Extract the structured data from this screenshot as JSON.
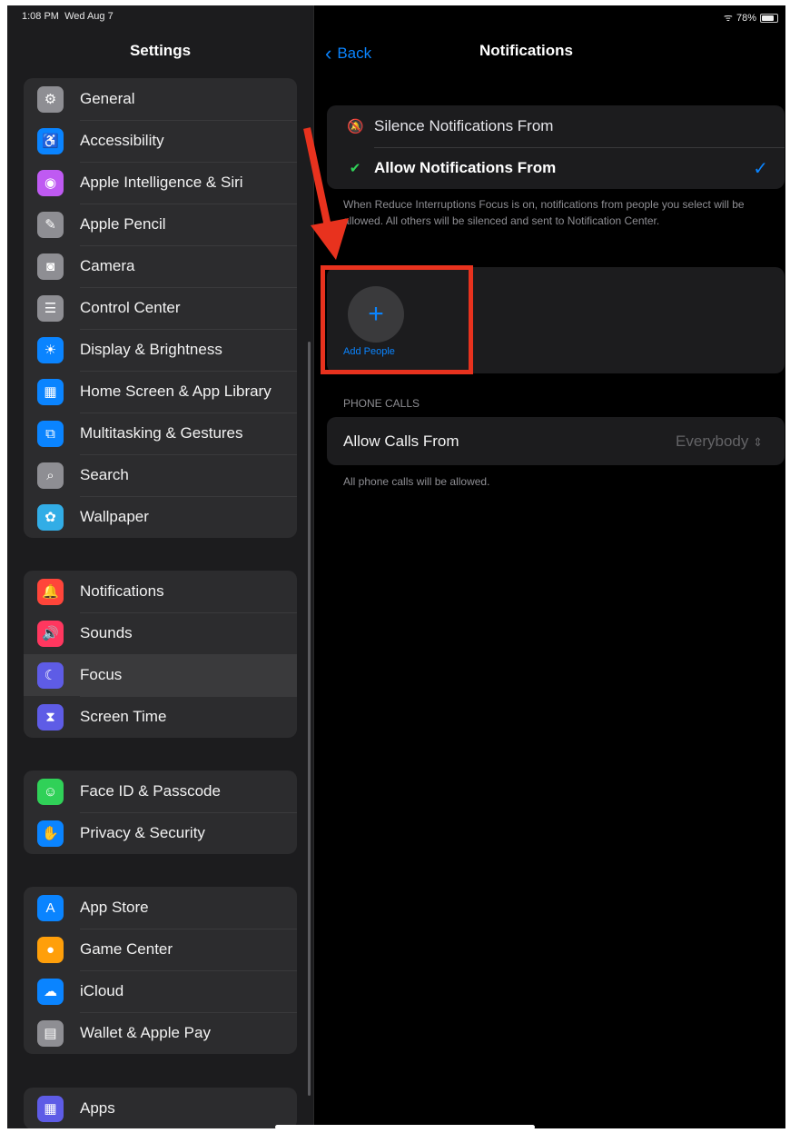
{
  "status": {
    "time": "1:08 PM",
    "date": "Wed Aug 7",
    "battery": "78%"
  },
  "sidebar": {
    "title": "Settings",
    "groups": [
      [
        {
          "label": "General",
          "icon": "gear-icon",
          "color": "#8e8e93"
        },
        {
          "label": "Accessibility",
          "icon": "accessibility-icon",
          "color": "#0a84ff"
        },
        {
          "label": "Apple Intelligence & Siri",
          "icon": "siri-icon",
          "color": "#bf5af2"
        },
        {
          "label": "Apple Pencil",
          "icon": "pencil-icon",
          "color": "#8e8e93"
        },
        {
          "label": "Camera",
          "icon": "camera-icon",
          "color": "#8e8e93"
        },
        {
          "label": "Control Center",
          "icon": "control-center-icon",
          "color": "#8e8e93"
        },
        {
          "label": "Display & Brightness",
          "icon": "sun-icon",
          "color": "#0a84ff"
        },
        {
          "label": "Home Screen & App Library",
          "icon": "home-screen-icon",
          "color": "#0a84ff"
        },
        {
          "label": "Multitasking & Gestures",
          "icon": "multitasking-icon",
          "color": "#0a84ff"
        },
        {
          "label": "Search",
          "icon": "search-icon",
          "color": "#8e8e93"
        },
        {
          "label": "Wallpaper",
          "icon": "wallpaper-icon",
          "color": "#32ade6"
        }
      ],
      [
        {
          "label": "Notifications",
          "icon": "bell-icon",
          "color": "#ff453a"
        },
        {
          "label": "Sounds",
          "icon": "speaker-icon",
          "color": "#ff375f"
        },
        {
          "label": "Focus",
          "icon": "moon-icon",
          "color": "#5e5ce6",
          "selected": true
        },
        {
          "label": "Screen Time",
          "icon": "hourglass-icon",
          "color": "#5e5ce6"
        }
      ],
      [
        {
          "label": "Face ID & Passcode",
          "icon": "face-id-icon",
          "color": "#30d158"
        },
        {
          "label": "Privacy & Security",
          "icon": "hand-icon",
          "color": "#0a84ff"
        }
      ],
      [
        {
          "label": "App Store",
          "icon": "app-store-icon",
          "color": "#0a84ff"
        },
        {
          "label": "Game Center",
          "icon": "game-center-icon",
          "color": "#ff9f0a"
        },
        {
          "label": "iCloud",
          "icon": "cloud-icon",
          "color": "#0a84ff"
        },
        {
          "label": "Wallet & Apple Pay",
          "icon": "wallet-icon",
          "color": "#8e8e93"
        }
      ],
      [
        {
          "label": "Apps",
          "icon": "apps-icon",
          "color": "#5e5ce6"
        }
      ]
    ]
  },
  "detail": {
    "back_label": "Back",
    "title": "Notifications",
    "options": [
      {
        "label": "Silence Notifications From",
        "icon": "bell-slash-icon",
        "selected": false
      },
      {
        "label": "Allow Notifications From",
        "icon": "checkmark-badge-icon",
        "selected": true
      }
    ],
    "options_footnote": "When Reduce Interruptions Focus is on, notifications from people you select will be allowed. All others will be silenced and sent to Notification Center.",
    "add_people_label": "Add People",
    "phone_calls_header": "PHONE CALLS",
    "allow_calls_label": "Allow Calls From",
    "allow_calls_value": "Everybody",
    "calls_footnote": "All phone calls will be allowed."
  },
  "annotation": {
    "color": "#e8321e"
  }
}
